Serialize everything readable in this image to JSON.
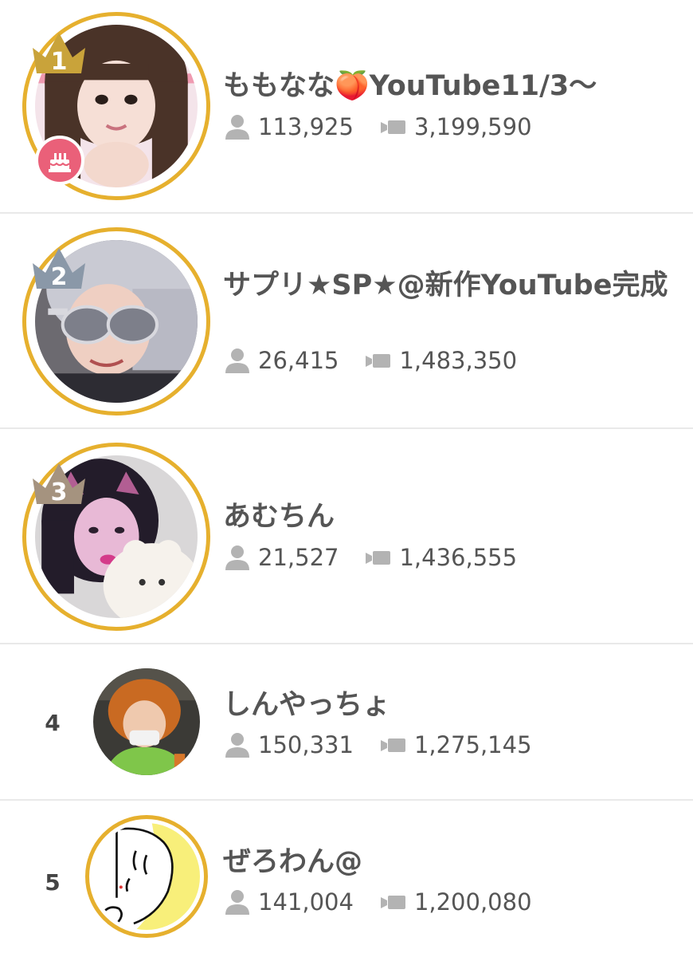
{
  "colors": {
    "ring": "#e6b02e",
    "gold_crown": "#c9a33a",
    "silver_crown": "#8a98a8",
    "bronze_crown": "#a5937f",
    "badge": "#ea6079",
    "text": "#555555",
    "icon": "#b3b3b3",
    "divider": "#e9e9e9"
  },
  "ranking": [
    {
      "rank": "1",
      "name": "ももなな🍑YouTube11/3〜",
      "followers": "113,925",
      "views": "3,199,590",
      "crown": "gold-crown-icon",
      "badge": "birthday-cake-icon"
    },
    {
      "rank": "2",
      "name": "サプリ★SP★@新作YouTube完成",
      "followers": "26,415",
      "views": "1,483,350",
      "crown": "silver-crown-icon"
    },
    {
      "rank": "3",
      "name": "あむちん",
      "followers": "21,527",
      "views": "1,436,555",
      "crown": "bronze-crown-icon"
    },
    {
      "rank": "4",
      "name": "しんやっちょ",
      "followers": "150,331",
      "views": "1,275,145"
    },
    {
      "rank": "5",
      "name": "ぜろわん@",
      "followers": "141,004",
      "views": "1,200,080"
    }
  ],
  "icons": {
    "followers": "person-icon",
    "views": "video-camera-icon"
  }
}
